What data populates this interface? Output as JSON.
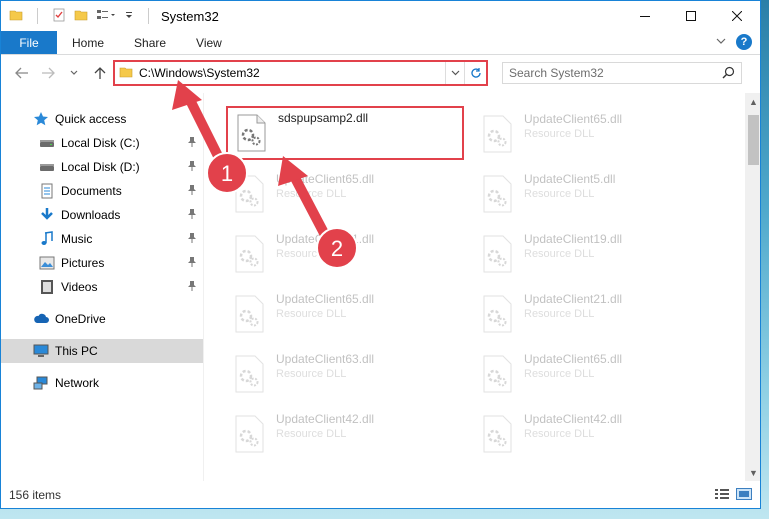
{
  "window": {
    "title": "System32",
    "minimize_glyph": "—",
    "maximize_glyph": "☐",
    "close_glyph": "✕"
  },
  "ribbon": {
    "tabs": [
      "File",
      "Home",
      "Share",
      "View"
    ],
    "help": "?"
  },
  "address": {
    "path": "C:\\Windows\\System32",
    "search_placeholder": "Search System32"
  },
  "sidebar": {
    "items": [
      {
        "label": "Quick access",
        "icon": "star-icon",
        "pinned": false,
        "level": 0
      },
      {
        "label": "Local Disk (C:)",
        "icon": "drive-icon",
        "pinned": true,
        "level": 1
      },
      {
        "label": "Local Disk (D:)",
        "icon": "drive-icon",
        "pinned": true,
        "level": 1
      },
      {
        "label": "Documents",
        "icon": "documents-icon",
        "pinned": true,
        "level": 1
      },
      {
        "label": "Downloads",
        "icon": "download-icon",
        "pinned": true,
        "level": 1
      },
      {
        "label": "Music",
        "icon": "music-icon",
        "pinned": true,
        "level": 1
      },
      {
        "label": "Pictures",
        "icon": "pictures-icon",
        "pinned": true,
        "level": 1
      },
      {
        "label": "Videos",
        "icon": "videos-icon",
        "pinned": true,
        "level": 1
      },
      {
        "label": "OneDrive",
        "icon": "cloud-icon",
        "pinned": false,
        "level": 0
      },
      {
        "label": "This PC",
        "icon": "computer-icon",
        "pinned": false,
        "level": 0,
        "selected": true
      },
      {
        "label": "Network",
        "icon": "network-icon",
        "pinned": false,
        "level": 0
      }
    ]
  },
  "files": [
    {
      "name": "sdspupsamp2.dll",
      "type": "",
      "highlighted": true
    },
    {
      "name": "UpdateClient65.dll",
      "type": "Resource DLL"
    },
    {
      "name": "UpdateClient65.dll",
      "type": "Resource DLL"
    },
    {
      "name": "UpdateClient5.dll",
      "type": "Resource DLL"
    },
    {
      "name": "UpdateClient21.dll",
      "type": "Resource DLL"
    },
    {
      "name": "UpdateClient19.dll",
      "type": "Resource DLL"
    },
    {
      "name": "UpdateClient65.dll",
      "type": "Resource DLL"
    },
    {
      "name": "UpdateClient21.dll",
      "type": "Resource DLL"
    },
    {
      "name": "UpdateClient63.dll",
      "type": "Resource DLL"
    },
    {
      "name": "UpdateClient65.dll",
      "type": "Resource DLL"
    },
    {
      "name": "UpdateClient42.dll",
      "type": "Resource DLL"
    },
    {
      "name": "UpdateClient42.dll",
      "type": "Resource DLL"
    }
  ],
  "status": {
    "item_count": "156 items"
  },
  "annotations": {
    "marker1": "1",
    "marker2": "2",
    "accent": "#e2414b"
  }
}
